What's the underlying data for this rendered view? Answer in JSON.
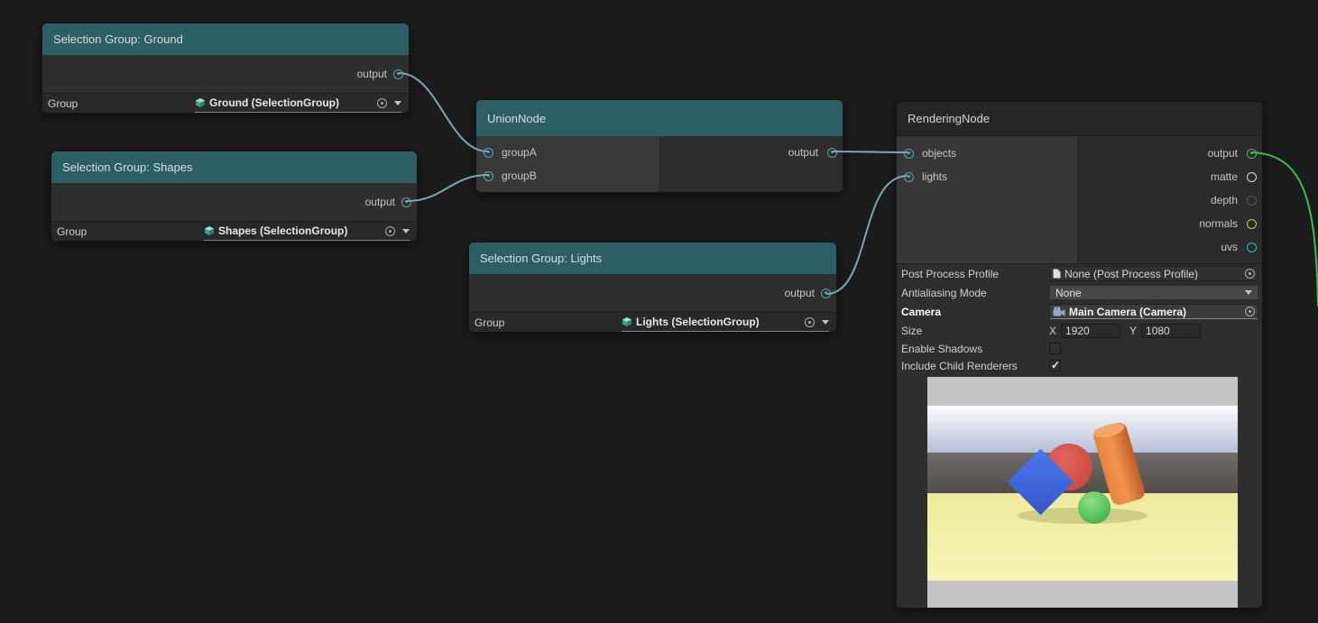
{
  "canvas": {
    "background": "#1c1c1c",
    "wire_color": "#7ba6b6",
    "wire_color_green": "#3dbb4d",
    "port_color_teal": "#55a6ab"
  },
  "nodes": {
    "ground": {
      "title": "Selection Group: Ground",
      "output_port": "output",
      "group_label": "Group",
      "group_value": "Ground (SelectionGroup)"
    },
    "shapes": {
      "title": "Selection Group: Shapes",
      "output_port": "output",
      "group_label": "Group",
      "group_value": "Shapes (SelectionGroup)"
    },
    "lights": {
      "title": "Selection Group: Lights",
      "output_port": "output",
      "group_label": "Group",
      "group_value": "Lights (SelectionGroup)"
    },
    "union": {
      "title": "UnionNode",
      "input_a": "groupA",
      "input_b": "groupB",
      "output_port": "output"
    },
    "rendering": {
      "title": "RenderingNode",
      "input_objects": "objects",
      "input_lights": "lights",
      "out_output": {
        "label": "output",
        "color": "#3dbb4d"
      },
      "out_matte": {
        "label": "matte",
        "color": "#d8d8d8"
      },
      "out_depth": {
        "label": "depth",
        "color": "#565656"
      },
      "out_normals": {
        "label": "normals",
        "color": "#d2c43e"
      },
      "out_uvs": {
        "label": "uvs",
        "color": "#2fbdbd"
      },
      "props": {
        "post_process": {
          "label": "Post Process Profile",
          "value": "None (Post Process Profile)"
        },
        "antialiasing": {
          "label": "Antialiasing Mode",
          "value": "None"
        },
        "camera": {
          "label": "Camera",
          "value": "Main Camera (Camera)"
        },
        "size": {
          "label": "Size",
          "x_label": "X",
          "x_value": "1920",
          "y_label": "Y",
          "y_value": "1080"
        },
        "enable_shadows": {
          "label": "Enable Shadows",
          "checked": false
        },
        "include_child_renderers": {
          "label": "Include Child Renderers",
          "checked": true
        }
      }
    }
  },
  "icons": {
    "selection_group_icon": "cube",
    "camera_icon": "movie-camera",
    "profile_icon": "document",
    "object_picker_icon": "circle-dot",
    "dropdown_caret_icon": "triangle-down",
    "checkmark_icon": "check"
  }
}
